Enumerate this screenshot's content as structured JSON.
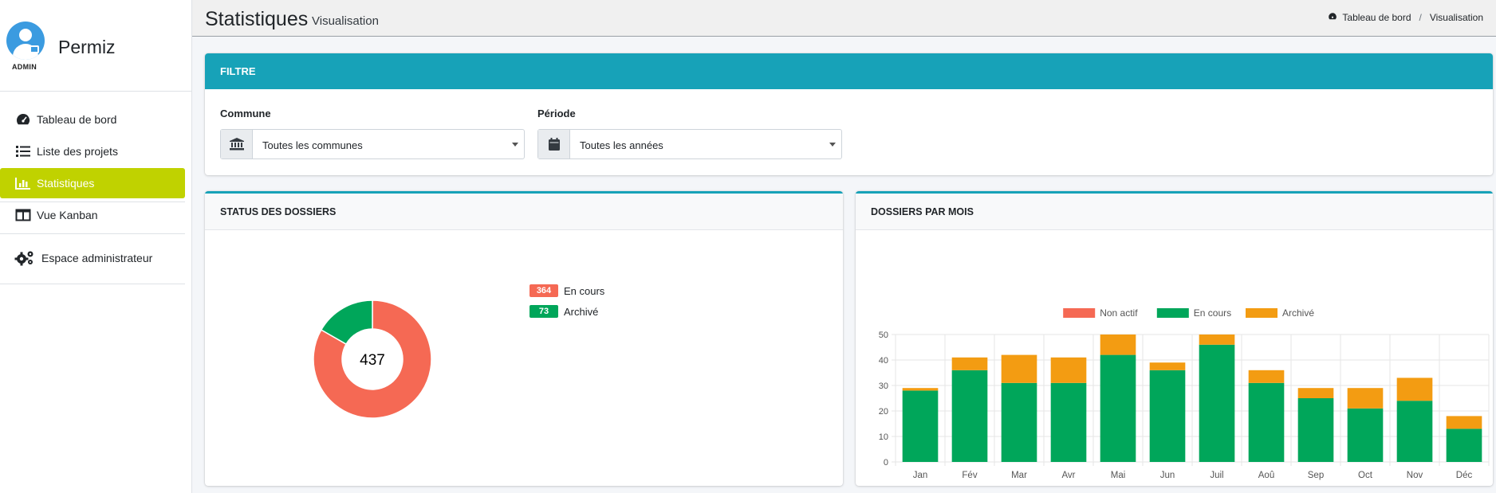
{
  "sidebar": {
    "brand": "Permiz",
    "role": "ADMIN",
    "items": [
      {
        "label": "Tableau de bord",
        "icon": "tachometer-icon"
      },
      {
        "label": "Liste des projets",
        "icon": "list-icon"
      },
      {
        "label": "Statistiques",
        "icon": "bar-chart-icon"
      },
      {
        "label": "Vue Kanban",
        "icon": "columns-icon"
      },
      {
        "label": "Espace administrateur",
        "icon": "cogs-icon"
      }
    ]
  },
  "header": {
    "title": "Statistiques",
    "subtitle": "Visualisation",
    "breadcrumb": [
      "Tableau de bord",
      "Visualisation"
    ]
  },
  "filter": {
    "title": "FILTRE",
    "commune_label": "Commune",
    "commune_value": "Toutes les communes",
    "periode_label": "Période",
    "periode_value": "Toutes les années"
  },
  "status": {
    "title": "STATUS DES DOSSIERS",
    "total": "437",
    "legend": [
      {
        "count": "364",
        "label": "En cours",
        "color": "#f56954"
      },
      {
        "count": "73",
        "label": "Archivé",
        "color": "#00a65a"
      }
    ]
  },
  "monthly": {
    "title": "DOSSIERS PAR MOIS"
  },
  "colors": {
    "accent": "#17a2b8",
    "active_nav": "#c0d200",
    "red": "#f56954",
    "green": "#00a65a",
    "orange": "#f39c12"
  },
  "chart_data": [
    {
      "type": "pie",
      "title": "STATUS DES DOSSIERS",
      "center_label": "437",
      "slices": [
        {
          "label": "En cours",
          "value": 364,
          "color": "#f56954"
        },
        {
          "label": "Archivé",
          "value": 73,
          "color": "#00a65a"
        }
      ]
    },
    {
      "type": "bar",
      "stacked": true,
      "title": "DOSSIERS PAR MOIS",
      "categories": [
        "Jan",
        "Fév",
        "Mar",
        "Avr",
        "Mai",
        "Jun",
        "Juil",
        "Aoû",
        "Sep",
        "Oct",
        "Nov",
        "Déc"
      ],
      "series": [
        {
          "name": "Non actif",
          "color": "#f56954",
          "values": [
            0,
            0,
            0,
            0,
            0,
            0,
            0,
            0,
            0,
            0,
            0,
            0
          ]
        },
        {
          "name": "En cours",
          "color": "#00a65a",
          "values": [
            28,
            36,
            31,
            31,
            42,
            36,
            46,
            31,
            25,
            21,
            24,
            13
          ]
        },
        {
          "name": "Archivé",
          "color": "#f39c12",
          "values": [
            1,
            5,
            11,
            10,
            8,
            3,
            4,
            5,
            4,
            8,
            9,
            5
          ]
        }
      ],
      "ylim": [
        0,
        50
      ],
      "yticks": [
        0,
        10,
        20,
        30,
        40,
        50
      ],
      "grid": true,
      "legend": "top"
    }
  ]
}
